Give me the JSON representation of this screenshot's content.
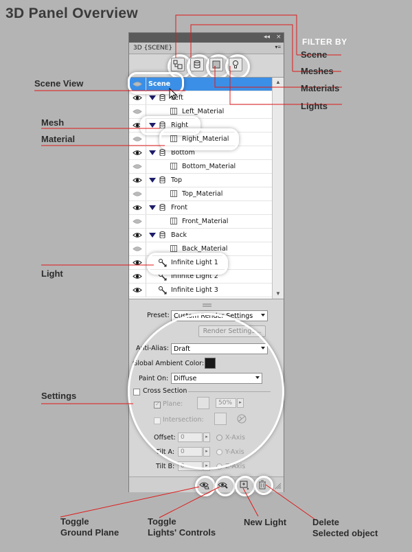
{
  "page_title": "3D Panel Overview",
  "panel": {
    "tab_title": "3D {SCENE}",
    "titlebar_collapse": "◂◂",
    "titlebar_close": "×",
    "menu_glyph": "▾≡"
  },
  "filter_buttons": [
    {
      "name": "scene",
      "icon": "scene-filter-icon"
    },
    {
      "name": "meshes",
      "icon": "mesh-filter-icon"
    },
    {
      "name": "materials",
      "icon": "material-filter-icon"
    },
    {
      "name": "lights",
      "icon": "light-filter-icon"
    }
  ],
  "scene_list": [
    {
      "label": "Scene",
      "type": "scene",
      "selected": true
    },
    {
      "label": "Left",
      "type": "mesh"
    },
    {
      "label": "Left_Material",
      "type": "material"
    },
    {
      "label": "Right",
      "type": "mesh"
    },
    {
      "label": "Right_Material",
      "type": "material"
    },
    {
      "label": "Bottom",
      "type": "mesh"
    },
    {
      "label": "Bottom_Material",
      "type": "material"
    },
    {
      "label": "Top",
      "type": "mesh"
    },
    {
      "label": "Top_Material",
      "type": "material"
    },
    {
      "label": "Front",
      "type": "mesh"
    },
    {
      "label": "Front_Material",
      "type": "material"
    },
    {
      "label": "Back",
      "type": "mesh"
    },
    {
      "label": "Back_Material",
      "type": "material"
    },
    {
      "label": "Infinite Light 1",
      "type": "light"
    },
    {
      "label": "Infinite Light 2",
      "type": "light"
    },
    {
      "label": "Infinite Light 3",
      "type": "light"
    }
  ],
  "settings": {
    "preset_label": "Preset:",
    "preset_value": "Custom Render Settings",
    "render_settings_button": "Render Settings...",
    "anti_alias_label": "Anti-Alias:",
    "anti_alias_value": "Draft",
    "ambient_label": "Global Ambient Color:",
    "ambient_color": "#1a1a1a",
    "paint_on_label": "Paint On:",
    "paint_on_value": "Diffuse",
    "cross_section_label": "Cross Section",
    "plane_label": "Plane:",
    "plane_opacity": "50%",
    "intersection_label": "Intersection:",
    "offset_label": "Offset:",
    "offset_value": "0",
    "tilt_a_label": "Tilt A:",
    "tilt_a_value": "0",
    "tilt_b_label": "Tilt B:",
    "tilt_b_value": "0",
    "x_axis": "X-Axis",
    "y_axis": "Y-Axis",
    "z_axis": "Z-Axis"
  },
  "callouts": {
    "filter_by": "FILTER BY",
    "scene": "Scene",
    "meshes": "Meshes",
    "materials": "Materials",
    "lights": "Lights",
    "scene_view": "Scene View",
    "mesh": "Mesh",
    "material": "Material",
    "light": "Light",
    "settings": "Settings",
    "toggle_ground_line1": "Toggle",
    "toggle_ground_line2": "Ground Plane",
    "toggle_lights_line1": "Toggle",
    "toggle_lights_line2": "Lights' Controls",
    "new_light": "New Light",
    "delete_line1": "Delete",
    "delete_line2": "Selected object"
  },
  "colors": {
    "callout_line": "#e01818",
    "selection": "#3b8fe6",
    "background": "#b4b4b4"
  }
}
